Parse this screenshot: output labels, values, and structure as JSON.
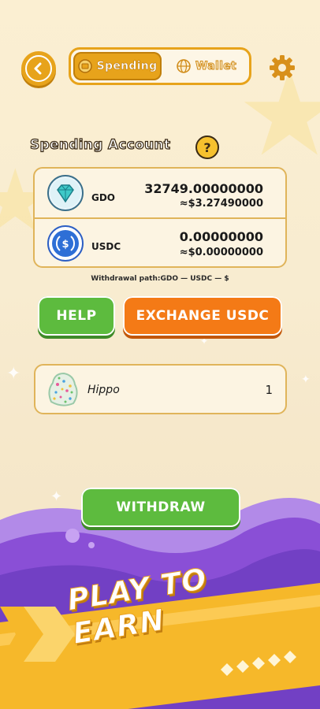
{
  "header": {
    "tabs": [
      {
        "label": "Spending",
        "active": true
      },
      {
        "label": "Wallet",
        "active": false
      }
    ]
  },
  "account": {
    "title": "Spending Account",
    "help_symbol": "?",
    "rows": [
      {
        "currency": "GDO",
        "amount": "32749.00000000",
        "usd": "≈$3.27490000",
        "icon": "diamond-icon"
      },
      {
        "currency": "USDC",
        "amount": "0.00000000",
        "usd": "≈$0.00000000",
        "icon": "usdc-coin-icon"
      }
    ],
    "withdrawal_path": "Withdrawal path:GDO — USDC — $"
  },
  "actions": {
    "help_label": "HELP",
    "exchange_label": "EXCHANGE USDC"
  },
  "items": [
    {
      "name": "Hippo",
      "count": "1"
    }
  ],
  "withdraw_label": "WITHDRAW",
  "banner": {
    "text": "PLAY TO EARN"
  },
  "colors": {
    "accent_orange": "#e7a31b",
    "green": "#5dbb3e",
    "orange_button": "#f47a16",
    "purple": "#8a4fd6",
    "banner_yellow": "#f6b82a"
  }
}
